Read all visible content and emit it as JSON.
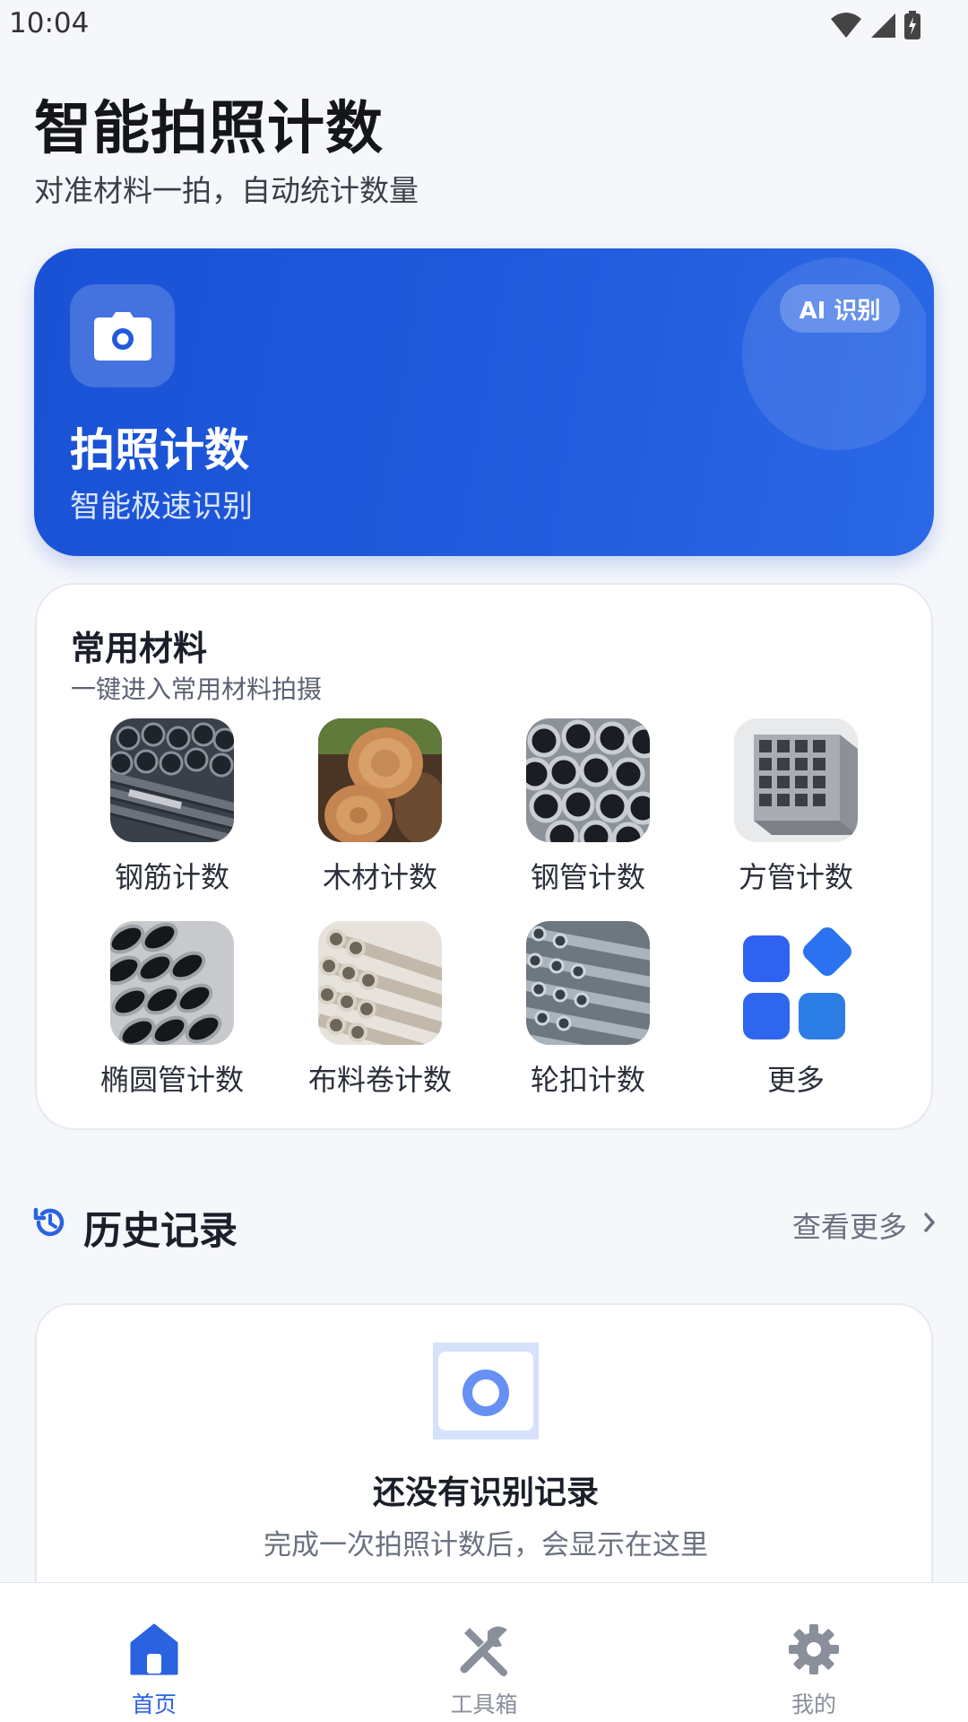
{
  "status_bar": {
    "time": "10:04"
  },
  "header": {
    "title": "智能拍照计数",
    "subtitle": "对准材料一拍，自动统计数量"
  },
  "hero": {
    "title": "拍照计数",
    "subtitle": "智能极速识别",
    "badge": "AI 识别",
    "icon": "camera-icon"
  },
  "materials": {
    "title": "常用材料",
    "subtitle": "一键进入常用材料拍摄",
    "items": [
      {
        "label": "钢筋计数",
        "icon": "rebar-thumbnail"
      },
      {
        "label": "木材计数",
        "icon": "timber-thumbnail"
      },
      {
        "label": "钢管计数",
        "icon": "steel-pipe-thumbnail"
      },
      {
        "label": "方管计数",
        "icon": "square-tube-thumbnail"
      },
      {
        "label": "椭圆管计数",
        "icon": "oval-tube-thumbnail"
      },
      {
        "label": "布料卷计数",
        "icon": "fabric-roll-thumbnail"
      },
      {
        "label": "轮扣计数",
        "icon": "scaffold-pipe-thumbnail"
      },
      {
        "label": "更多",
        "icon": "more-apps-icon"
      }
    ]
  },
  "history": {
    "title": "历史记录",
    "more_label": "查看更多",
    "empty_title": "还没有识别记录",
    "empty_subtitle": "完成一次拍照计数后，会显示在这里"
  },
  "bottom_nav": {
    "items": [
      {
        "label": "首页",
        "icon": "home-icon",
        "active": true
      },
      {
        "label": "工具箱",
        "icon": "tools-icon",
        "active": false
      },
      {
        "label": "我的",
        "icon": "gear-icon",
        "active": false
      }
    ]
  },
  "colors": {
    "accent": "#2a62e0",
    "hero_gradient_start": "#1a52d6",
    "hero_gradient_end": "#2a68e6",
    "background": "#f5f7fb"
  }
}
